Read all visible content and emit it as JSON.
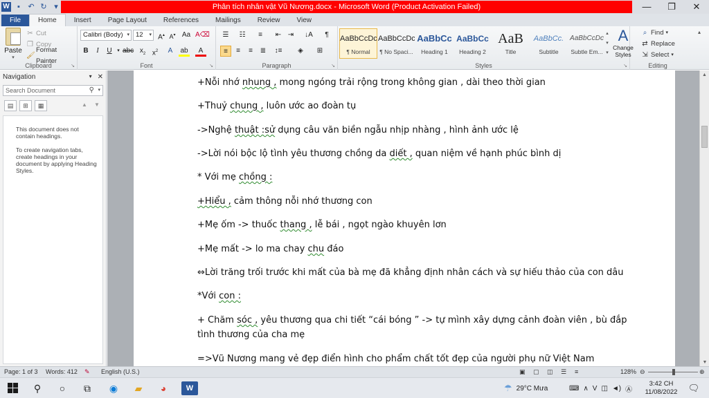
{
  "window": {
    "title": "Phân tích nhân vật Vũ Nương.docx  -  Microsoft Word (Product Activation Failed)",
    "minimize": "—",
    "maximize": "❐",
    "close": "✕"
  },
  "tabs": [
    "File",
    "Home",
    "Insert",
    "Page Layout",
    "References",
    "Mailings",
    "Review",
    "View"
  ],
  "clipboard": {
    "paste": "Paste",
    "cut": "Cut",
    "copy": "Copy",
    "format_painter": "Format Painter",
    "label": "Clipboard"
  },
  "font": {
    "name": "Calibri (Body)",
    "size": "12",
    "label": "Font"
  },
  "paragraph": {
    "label": "Paragraph"
  },
  "styles": {
    "label": "Styles",
    "items": [
      {
        "preview": "AaBbCcDc",
        "name": "¶ Normal"
      },
      {
        "preview": "AaBbCcDc",
        "name": "¶ No Spaci..."
      },
      {
        "preview": "AaBbCc",
        "name": "Heading 1"
      },
      {
        "preview": "AaBbCc",
        "name": "Heading 2"
      },
      {
        "preview": "AaB",
        "name": "Title"
      },
      {
        "preview": "AaBbCc.",
        "name": "Subtitle"
      },
      {
        "preview": "AaBbCcDc",
        "name": "Subtle Em..."
      }
    ],
    "change_styles": "Change Styles"
  },
  "editing": {
    "find": "Find",
    "replace": "Replace",
    "select": "Select",
    "label": "Editing"
  },
  "navigation": {
    "title": "Navigation",
    "search_placeholder": "Search Document",
    "msg1": "This document does not contain headings.",
    "msg2": "To create navigation tabs, create headings in your document by applying Heading Styles."
  },
  "document": {
    "lines": [
      [
        "+Nỗi nhớ ",
        {
          "sq": "nhung ,"
        },
        " mong ngóng trải rộng trong không gian , dài theo thời gian"
      ],
      [
        "+Thuỷ ",
        {
          "sq": "chung ,"
        },
        " luôn ước ao đoàn tụ"
      ],
      [
        "->Nghệ ",
        {
          "sq": "thuật :sử"
        },
        " dụng câu văn biền ngẫu nhịp nhàng , hình ảnh ước lệ"
      ],
      [
        "->Lời nói bộc lộ tình yêu thương chồng da ",
        {
          "sq": "diết ,"
        },
        " quan niệm về hạnh phúc bình dị"
      ],
      [
        "* Với mẹ ",
        {
          "sq": "chồng :"
        }
      ],
      [
        {
          "sq": "+Hiểu ,"
        },
        " cảm thông nỗi nhớ thương con"
      ],
      [
        "+Mẹ ốm -> thuốc ",
        {
          "sq": "thang ,"
        },
        " lễ bái , ngọt ngào khuyên lơn"
      ],
      [
        "+Mẹ mất -> lo ma chay ",
        {
          "sq": "chu"
        },
        " đáo"
      ],
      [
        "⇔Lời trăng trối trước khi mất của bà mẹ đã khẳng định nhân cách và sự hiếu thảo của con dâu"
      ],
      [
        "*Với ",
        {
          "sq": "con :"
        }
      ],
      [
        "+ Chăm ",
        {
          "sq": "sóc ,"
        },
        " yêu thương qua chi tiết “cái bóng ” -> tự mình xây dựng cảnh đoàn viên , bù đắp"
      ],
      [
        "tình thương của cha mẹ"
      ],
      [
        "=>Vũ Nương mang vẻ đẹp điển hình cho phẩm chất tốt đẹp của người phụ nữ Việt Nam"
      ]
    ]
  },
  "status": {
    "page": "Page: 1 of 3",
    "words": "Words: 412",
    "language": "English (U.S.)",
    "zoom": "128%"
  },
  "taskbar": {
    "weather": "29°C  Mưa",
    "time": "3:42 CH",
    "date": "11/08/2022"
  }
}
